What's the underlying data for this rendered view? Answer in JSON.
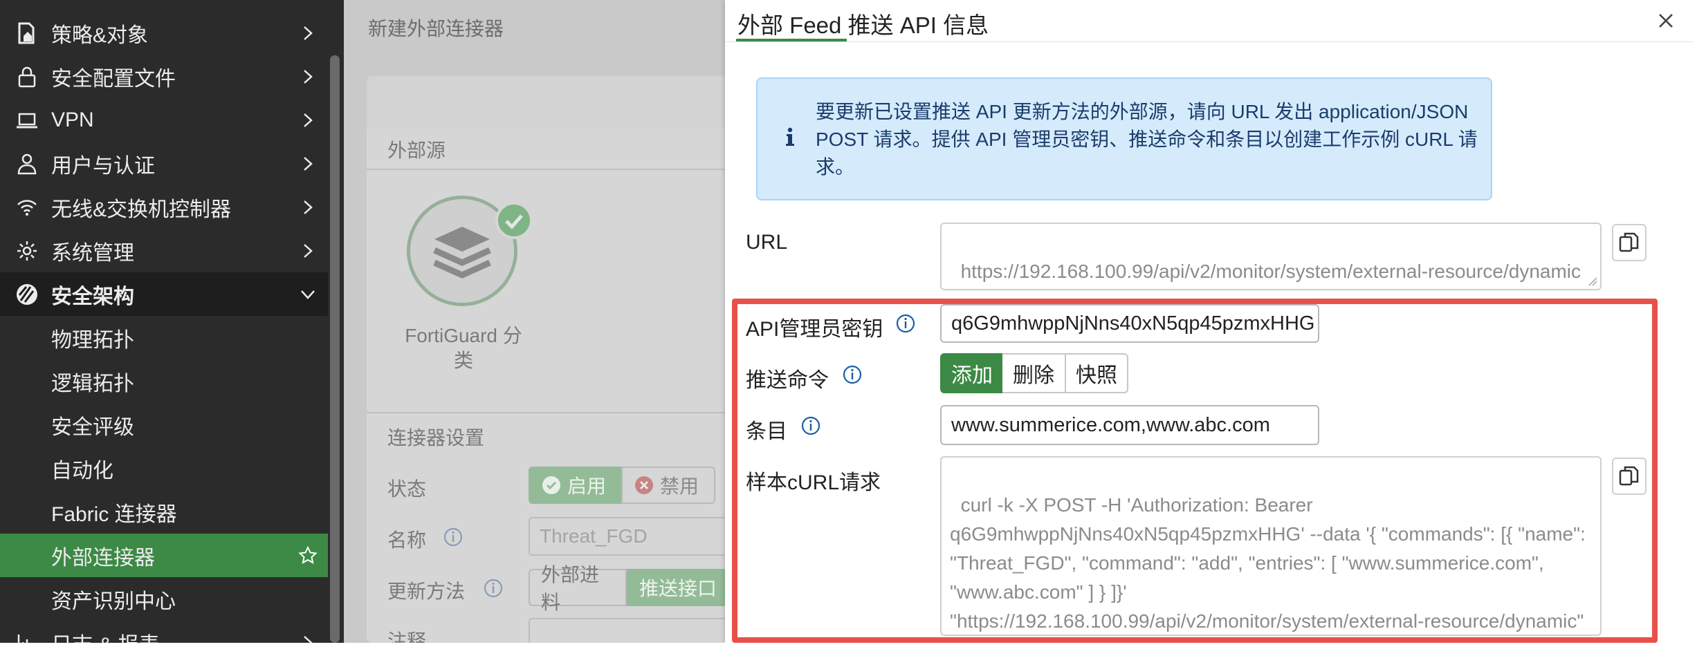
{
  "sidebar": {
    "items": [
      {
        "label": "策略&对象",
        "icon": "policy-doc-icon"
      },
      {
        "label": "安全配置文件",
        "icon": "lock-icon"
      },
      {
        "label": "VPN",
        "icon": "laptop-icon"
      },
      {
        "label": "用户与认证",
        "icon": "user-icon"
      },
      {
        "label": "无线&交换机控制器",
        "icon": "wifi-icon"
      },
      {
        "label": "系统管理",
        "icon": "gear-icon"
      },
      {
        "label": "安全架构",
        "icon": "security-fabric-icon"
      },
      {
        "label": "物理拓扑"
      },
      {
        "label": "逻辑拓扑"
      },
      {
        "label": "安全评级"
      },
      {
        "label": "自动化"
      },
      {
        "label": "Fabric 连接器"
      },
      {
        "label": "外部连接器"
      },
      {
        "label": "资产识别中心"
      },
      {
        "label": "日志 & 报表",
        "icon": "chart-icon"
      }
    ],
    "active_color": "#3c8a45"
  },
  "background_page": {
    "title": "新建外部连接器",
    "section_source": "外部源",
    "connector_name": "FortiGuard 分类",
    "section_settings": "连接器设置",
    "status_label": "状态",
    "status_enable": "启用",
    "status_disable": "禁用",
    "name_label": "名称",
    "name_value": "Threat_FGD",
    "update_method_label": "更新方法",
    "update_external": "外部进料",
    "update_push": "推送接口",
    "comment_label": "注释"
  },
  "drawer": {
    "title": "外部 Feed 推送 API 信息",
    "info_text": "要更新已设置推送 API 更新方法的外部源，请向 URL 发出 application/JSON POST 请求。提供 API 管理员密钥、推送命令和条目以创建工作示例 cURL 请求。",
    "url_label": "URL",
    "url_value": "https://192.168.100.99/api/v2/monitor/system/external-resource/dynamic",
    "api_key_label": "API管理员密钥",
    "api_key_value": "q6G9mhwppNjNns40xN5qp45pzmxHHG",
    "push_cmd_label": "推送命令",
    "push_cmd_options": [
      "添加",
      "删除",
      "快照"
    ],
    "push_cmd_selected": "添加",
    "entries_label": "条目",
    "entries_value": "www.summerice.com,www.abc.com",
    "sample_label": "样本cURL请求",
    "sample_value": "curl -k -X POST -H 'Authorization: Bearer q6G9mhwppNjNns40xN5qp45pzmxHHG' --data '{ \"commands\": [{ \"name\": \"Threat_FGD\", \"command\": \"add\", \"entries\": [ \"www.summerice.com\", \"www.abc.com\" ] } ]}' \"https://192.168.100.99/api/v2/monitor/system/external-resource/dynamic\"",
    "highlight_color": "#e8514a"
  }
}
